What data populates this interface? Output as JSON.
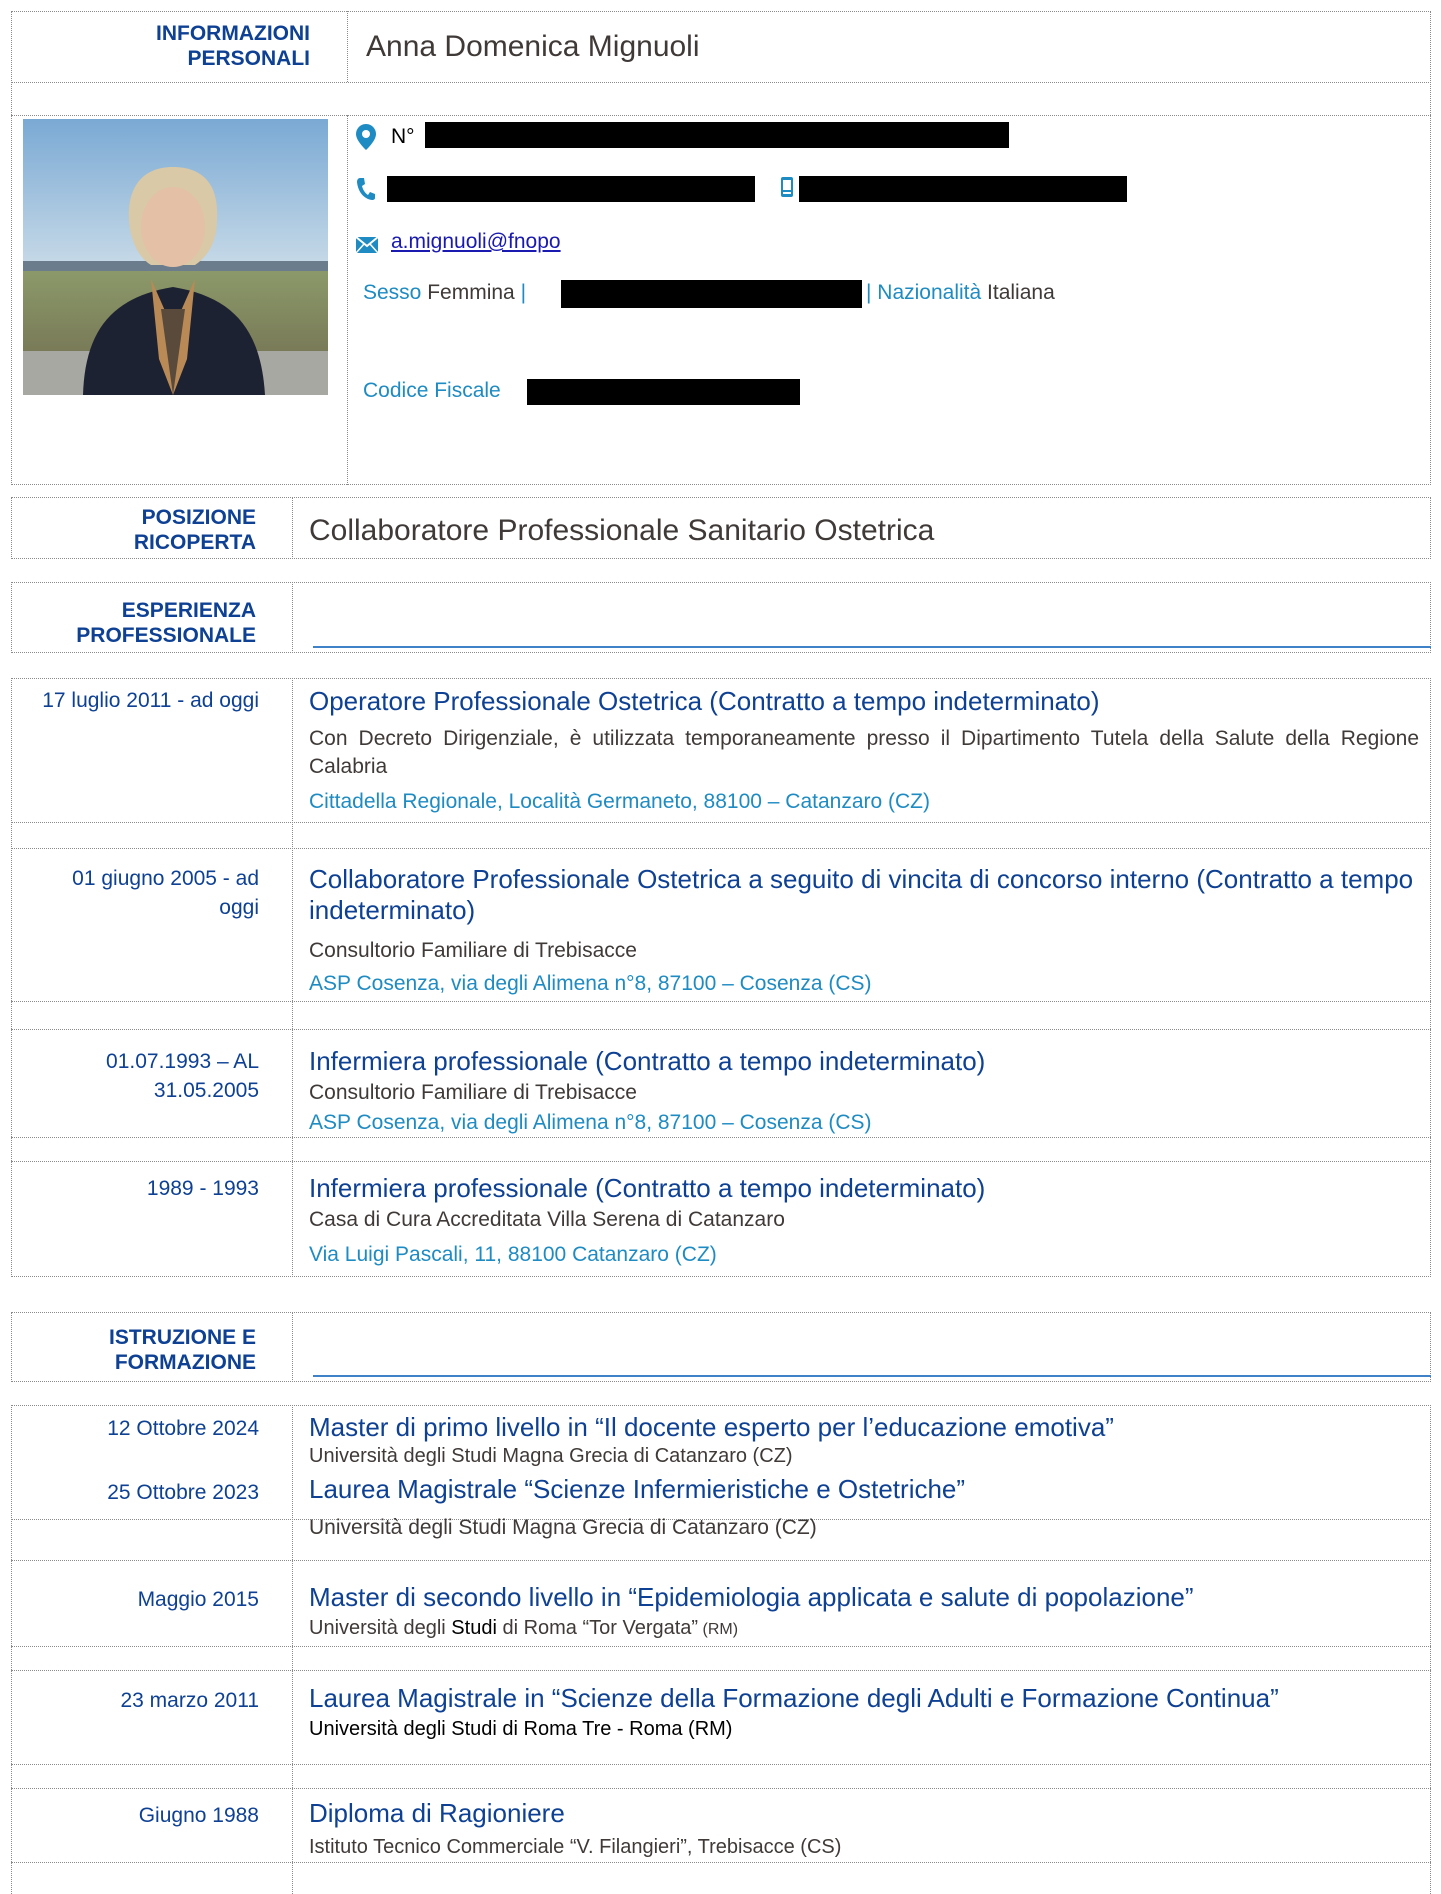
{
  "personal": {
    "header_label": "INFORMAZIONI PERSONALI",
    "name": "Anna Domenica Mignuoli",
    "address_prefix": "N°",
    "email": "a.mignuoli@fnopo",
    "sesso_label": "Sesso",
    "sesso_value": "Femmina",
    "separator": "|",
    "nazionalita_label": "| Nazionalità",
    "nazionalita_value": "Italiana",
    "codice_label": "Codice Fiscale",
    "icons": [
      "location-pin-icon",
      "phone-icon",
      "mobile-icon",
      "envelope-icon"
    ],
    "colors": {
      "heading": "#0e4194",
      "label": "#1e8bc3",
      "rule": "#3f82c8"
    }
  },
  "posizione": {
    "label": "POSIZIONE RICOPERTA",
    "value": "Collaboratore Professionale Sanitario Ostetrica"
  },
  "esperienza": {
    "label": "ESPERIENZA PROFESSIONALE",
    "items": [
      {
        "date": "17 luglio 2011 - ad oggi",
        "title": "Operatore Professionale Ostetrica (Contratto a tempo indeterminato)",
        "desc": "Con Decreto Dirigenziale, è utilizzata temporaneamente presso il Dipartimento Tutela della Salute della Regione Calabria",
        "addr": "Cittadella Regionale, Località Germaneto, 88100 – Catanzaro (CZ)"
      },
      {
        "date": "01 giugno 2005 - ad oggi",
        "title": "Collaboratore Professionale Ostetrica a seguito di vincita di concorso interno (Contratto a tempo indeterminato)",
        "desc": "Consultorio Familiare di Trebisacce",
        "addr": "ASP Cosenza, via degli Alimena n°8, 87100 – Cosenza (CS)"
      },
      {
        "date": "01.07.1993 – AL 31.05.2005",
        "title": "Infermiera professionale (Contratto a tempo indeterminato)",
        "desc": "Consultorio Familiare di Trebisacce",
        "addr": "ASP Cosenza, via degli Alimena n°8, 87100 – Cosenza (CS)"
      },
      {
        "date": "1989 - 1993",
        "title": "Infermiera professionale (Contratto a tempo indeterminato)",
        "desc": "Casa di Cura Accreditata Villa Serena di Catanzaro",
        "addr": "Via Luigi Pascali, 11, 88100 Catanzaro (CZ)"
      }
    ]
  },
  "istruzione": {
    "label": "ISTRUZIONE E FORMAZIONE",
    "items": [
      {
        "date": "12 Ottobre 2024",
        "title": "Master di primo livello in “Il docente esperto per l’educazione emotiva”",
        "desc": "Università degli Studi Magna Grecia di Catanzaro (CZ)"
      },
      {
        "date": "25 Ottobre 2023",
        "title": "Laurea Magistrale “Scienze Infermieristiche e Ostetriche”",
        "desc": "Università degli Studi Magna Grecia di Catanzaro (CZ)"
      },
      {
        "date": "Maggio 2015",
        "title": "Master di secondo livello in “Epidemiologia applicata e salute di popolazione”",
        "desc_a": "Università degli ",
        "desc_b": "Studi",
        "desc_c": " di Roma “Tor Vergata”",
        "desc_d": " (RM)"
      },
      {
        "date": "23 marzo 2011",
        "title": "Laurea Magistrale in “Scienze della Formazione degli Adulti e Formazione Continua”",
        "desc": "Università degli Studi di Roma Tre - Roma (RM)"
      },
      {
        "date": "Giugno 1988",
        "title": "Diploma di Ragioniere",
        "desc": "Istituto Tecnico Commerciale “V. Filangieri”, Trebisacce (CS)"
      }
    ]
  }
}
